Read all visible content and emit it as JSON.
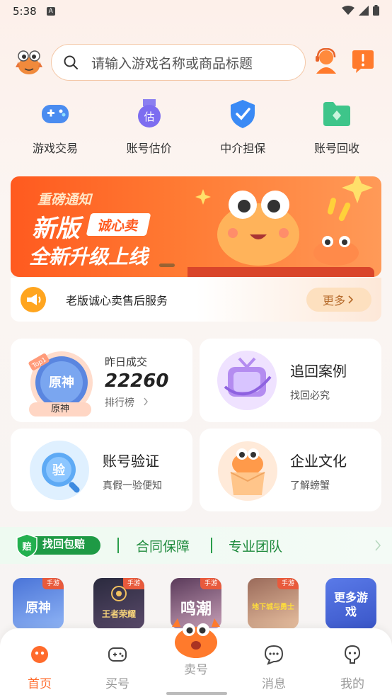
{
  "status": {
    "time": "5:38",
    "notif": "A"
  },
  "search": {
    "placeholder": "请输入游戏名称或商品标题"
  },
  "quick_nav": [
    {
      "label": "游戏交易",
      "icon": "gamepad-icon"
    },
    {
      "label": "账号估价",
      "icon": "valuation-badge-icon"
    },
    {
      "label": "中介担保",
      "icon": "shield-check-icon"
    },
    {
      "label": "账号回收",
      "icon": "recycle-folder-icon"
    }
  ],
  "banner": {
    "line1": "重磅通知",
    "line2": "新版",
    "badge": "诚心卖",
    "line3": "全新升级上线"
  },
  "notice": {
    "text": "老版诚心卖售后服务",
    "more": "更多"
  },
  "cards": {
    "ranking": {
      "title": "昨日成交",
      "value": "22260",
      "link": "排行榜",
      "game": "原神",
      "top_tag": "Top1"
    },
    "recover": {
      "title": "追回案例",
      "sub": "找回必究"
    },
    "verify": {
      "title": "账号验证",
      "sub": "真假一验便知",
      "icon_text": "验"
    },
    "culture": {
      "title": "企业文化",
      "sub": "了解螃蟹"
    }
  },
  "trust": {
    "badge_icon": "赔",
    "badge": "找回包赔",
    "item1": "合同保障",
    "item2": "专业团队"
  },
  "games": [
    {
      "name": "原神",
      "tag": "手游"
    },
    {
      "name": "王者荣耀",
      "tag": "手游"
    },
    {
      "name": "鸣潮",
      "tag": "手游"
    },
    {
      "name": "地下城与勇士",
      "tag": "手游"
    },
    {
      "name": "更多游戏",
      "tag": ""
    }
  ],
  "tabbar": {
    "home": "首页",
    "buy": "买号",
    "sell": "卖号",
    "message": "消息",
    "mine": "我的"
  },
  "colors": {
    "accent": "#ff6b2c",
    "green": "#1e8a3c",
    "blue": "#4b6fe0"
  }
}
